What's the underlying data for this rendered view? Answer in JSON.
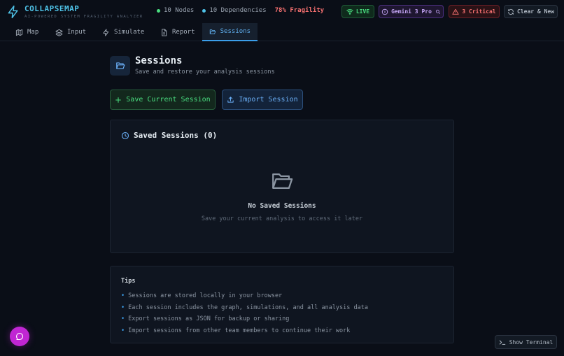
{
  "brand": {
    "name": "COLLAPSEMAP",
    "tagline": "AI-POWERED SYSTEM FRAGILITY ANALYZER",
    "accent": "#4fc3e8"
  },
  "stats": {
    "nodes": "10 Nodes",
    "nodes_color": "#4ade80",
    "dependencies": "10 Dependencies",
    "dependencies_color": "#4fc3e8",
    "fragility": "78% Fragility"
  },
  "badges": {
    "live": "LIVE",
    "model": "Gemini 3 Pro",
    "critical": "3 Critical",
    "clear": "Clear & New"
  },
  "tabs": [
    {
      "label": "Map",
      "icon": "map-icon",
      "active": false
    },
    {
      "label": "Input",
      "icon": "layers-icon",
      "active": false
    },
    {
      "label": "Simulate",
      "icon": "bolt-icon",
      "active": false
    },
    {
      "label": "Report",
      "icon": "document-icon",
      "active": false
    },
    {
      "label": "Sessions",
      "icon": "folder-open-icon",
      "active": true
    }
  ],
  "page": {
    "title": "Sessions",
    "subtitle": "Save and restore your analysis sessions"
  },
  "actions": {
    "save": "Save Current Session",
    "import": "Import Session"
  },
  "saved": {
    "title": "Saved Sessions (0)",
    "empty_title": "No Saved Sessions",
    "empty_subtitle": "Save your current analysis to access it later"
  },
  "tips": {
    "title": "Tips",
    "items": [
      "Sessions are stored locally in your browser",
      "Each session includes the graph, simulations, and all analysis data",
      "Export sessions as JSON for backup or sharing",
      "Import sessions from other team members to continue their work"
    ]
  },
  "footer": {
    "terminal": "Show Terminal"
  }
}
